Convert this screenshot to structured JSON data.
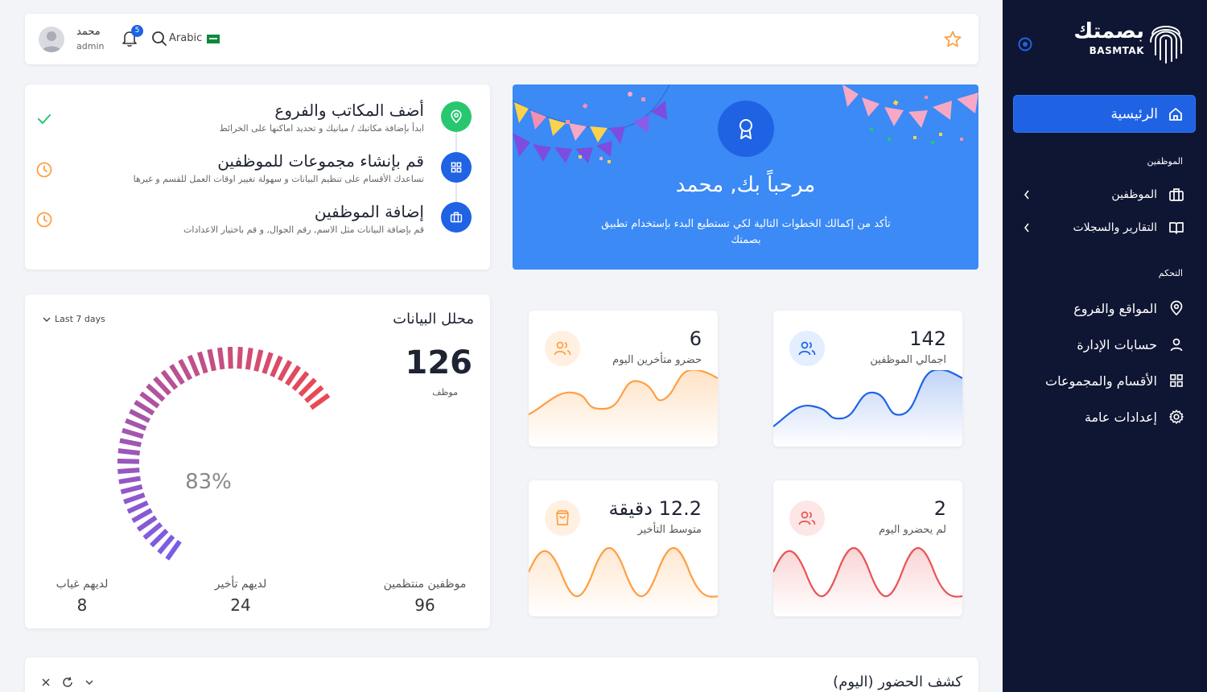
{
  "sidebar": {
    "logo_ar": "بصمتك",
    "logo_en": "BASMTAK",
    "home_label": "الرئيسية",
    "section_employees": "الموظفين",
    "items_employees": [
      {
        "label": "الموظفين",
        "icon": "briefcase-icon"
      },
      {
        "label": "التقارير والسجلات",
        "icon": "book-icon"
      }
    ],
    "section_control": "التحكم",
    "items_control": [
      {
        "label": "المواقع والفروع",
        "icon": "location-pin-icon"
      },
      {
        "label": "حسابات الإدارة",
        "icon": "user-icon"
      },
      {
        "label": "الأقسام والمجموعات",
        "icon": "grid-icon"
      },
      {
        "label": "إعدادات عامة",
        "icon": "gear-icon"
      }
    ]
  },
  "header": {
    "user_name": "محمد",
    "user_role": "admin",
    "notifications": "5",
    "language": "Arabic"
  },
  "welcome": {
    "title": "مرحباً بك, محمد",
    "desc": "تأكد من إكمالك الخطوات التالية لكي تستطيع البدء بإستخدام تطبيق بصمتك"
  },
  "steps": [
    {
      "title": "أضف المكاتب والفروع",
      "desc": "ابدأ بإضافة مكاتبك / مبانيك و تحديد اماكنها على الخرائط",
      "status": "done",
      "color": "#28c76f",
      "icon": "location-pin-icon"
    },
    {
      "title": "قم بإنشاء مجموعات للموظفين",
      "desc": "تساعدك الأقسام على تنظيم البيانات و سهولة تغيير اوقات العمل للقسم و غيرها",
      "status": "pending",
      "color": "#1f63e4",
      "icon": "grid-icon"
    },
    {
      "title": "إضافة الموظفين",
      "desc": "قم بإضافة البيانات مثل الاسم, رقم الجوال, و قم باختيار الاعدادات",
      "status": "pending",
      "color": "#1f63e4",
      "icon": "briefcase-icon"
    }
  ],
  "analysis": {
    "title": "محلل البيانات",
    "range": "Last 7 days",
    "total": "126",
    "total_label": "موظف",
    "percent": "83%",
    "percent_value": 83,
    "stats": [
      {
        "label": "موظفين منتظمين",
        "value": "96"
      },
      {
        "label": "لديهم تأخير",
        "value": "24"
      },
      {
        "label": "لديهم غياب",
        "value": "8"
      }
    ]
  },
  "stats": {
    "total": {
      "value": "142",
      "label": "اجمالي الموظفين",
      "color": "#1f63e4"
    },
    "late_today": {
      "value": "6",
      "label": "حضرو متأخرين اليوم",
      "color": "#ff9f43"
    },
    "absent": {
      "value": "2",
      "label": "لم يحضرو اليوم",
      "color": "#ea5455"
    },
    "avg_delay": {
      "value": "12.2 دقيقة",
      "label": "متوسط التأخير",
      "color": "#ff9f43"
    }
  },
  "attendance": {
    "title": "كشف الحضور (اليوم)"
  }
}
